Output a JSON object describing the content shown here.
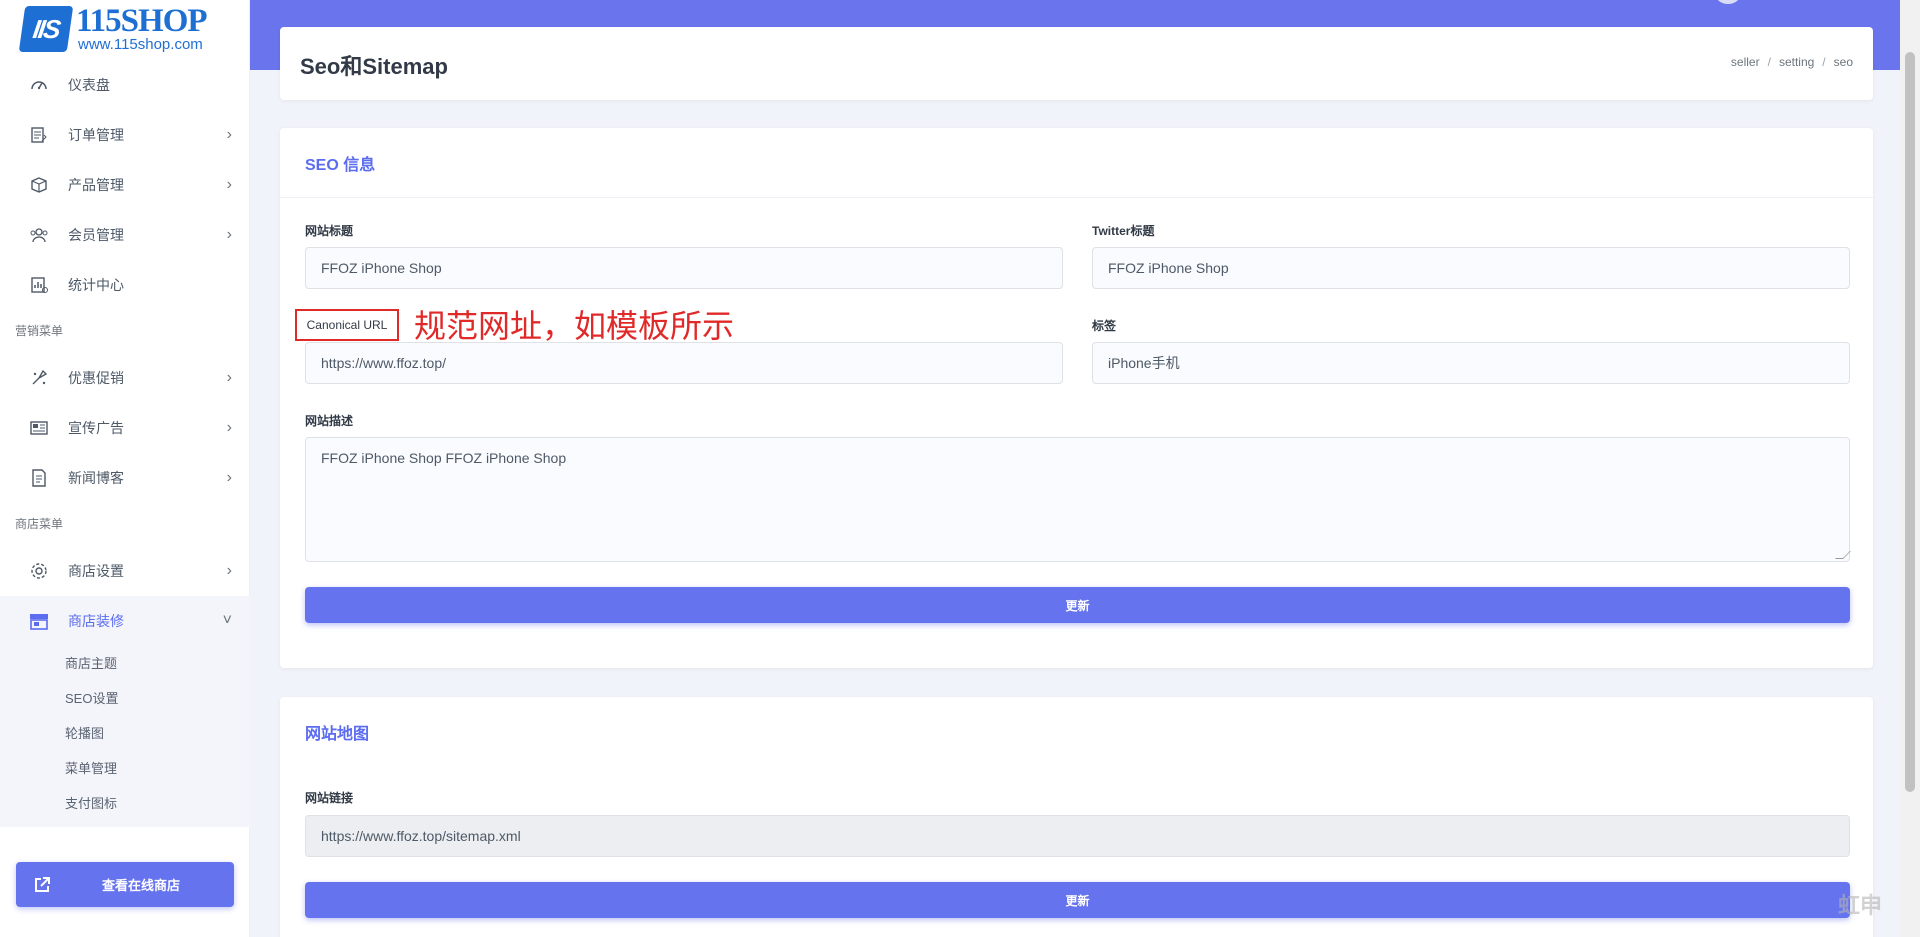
{
  "brand": {
    "name": "115SHOP",
    "url": "www.115shop.com",
    "mark": "IIS"
  },
  "sidebar": {
    "items": [
      {
        "label": "仪表盘",
        "icon": "dashboard-icon",
        "has_children": false
      },
      {
        "label": "订单管理",
        "icon": "order-icon",
        "has_children": true
      },
      {
        "label": "产品管理",
        "icon": "package-icon",
        "has_children": true
      },
      {
        "label": "会员管理",
        "icon": "users-icon",
        "has_children": true
      },
      {
        "label": "统计中心",
        "icon": "stats-icon",
        "has_children": false
      }
    ],
    "section_marketing": "营销菜单",
    "marketing_items": [
      {
        "label": "优惠促销",
        "icon": "promo-icon",
        "has_children": true
      },
      {
        "label": "宣传广告",
        "icon": "ads-icon",
        "has_children": true
      },
      {
        "label": "新闻博客",
        "icon": "news-icon",
        "has_children": true
      }
    ],
    "section_shop": "商店菜单",
    "shop_items": [
      {
        "label": "商店设置",
        "icon": "gear-icon",
        "has_children": true
      },
      {
        "label": "商店装修",
        "icon": "store-icon",
        "has_children": true,
        "expanded": true
      }
    ],
    "sub_items": [
      "商店主题",
      "SEO设置",
      "轮播图",
      "菜单管理",
      "支付图标"
    ],
    "chevron_right": "›",
    "chevron_down": "˅",
    "view_shop_button": "查看在线商店"
  },
  "header": {
    "title": "Seo和Sitemap",
    "breadcrumb": [
      "seller",
      "setting",
      "seo"
    ],
    "breadcrumb_sep": "/"
  },
  "seo_card": {
    "title": "SEO 信息",
    "site_title_label": "网站标题",
    "site_title_value": "FFOZ iPhone Shop",
    "twitter_title_label": "Twitter标题",
    "twitter_title_value": "FFOZ iPhone Shop",
    "canonical_label": "Canonical URL",
    "canonical_value": "https://www.ffoz.top/",
    "tags_label": "标签",
    "tags_value": "iPhone手机",
    "description_label": "网站描述",
    "description_value": "FFOZ iPhone Shop FFOZ iPhone Shop",
    "update_button": "更新"
  },
  "annotation": {
    "text": "规范网址，如模板所示",
    "color": "#e02a2a"
  },
  "sitemap_card": {
    "title": "网站地图",
    "link_label": "网站链接",
    "link_value": "https://www.ffoz.top/sitemap.xml",
    "update_button": "更新"
  },
  "watermark": "虹申",
  "colors": {
    "accent": "#6673ee",
    "topbar": "#6a74ec",
    "annotation": "#e02a2a"
  }
}
